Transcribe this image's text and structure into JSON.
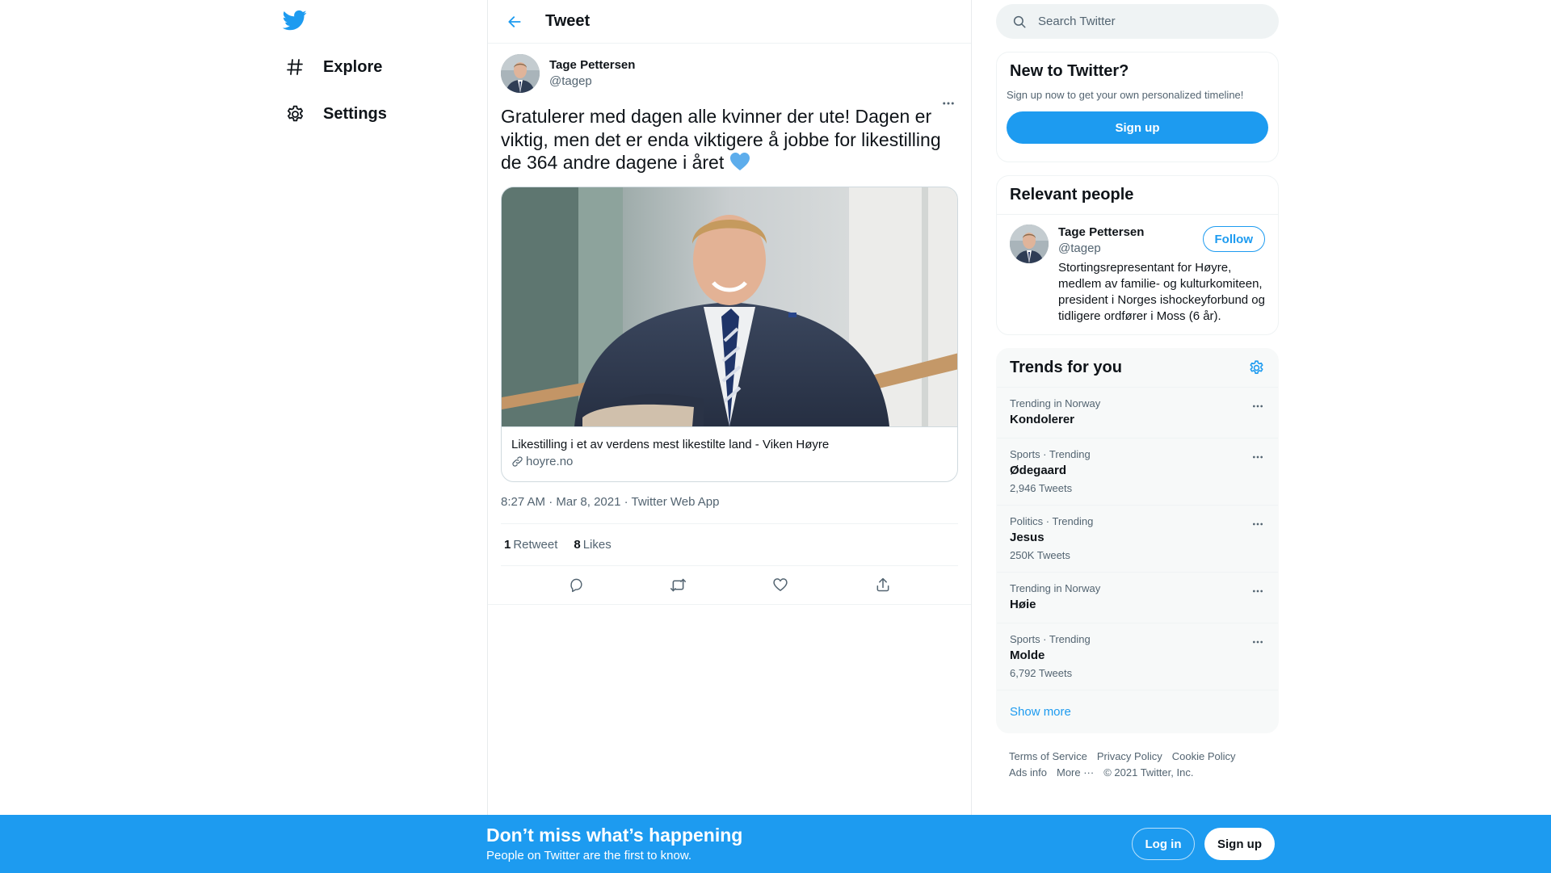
{
  "nav": {
    "items": [
      {
        "label": "Explore",
        "icon": "hashtag-icon"
      },
      {
        "label": "Settings",
        "icon": "gear-icon"
      }
    ]
  },
  "header": {
    "title": "Tweet"
  },
  "tweet": {
    "author_name": "Tage Pettersen",
    "author_handle": "@tagep",
    "text": "Gratulerer med dagen alle kvinner der ute! Dagen er viktig, men det er enda viktigere å jobbe for likestilling de 364 andre dagene i året",
    "emoji": "blue-heart",
    "card": {
      "title": "Likestilling i et av verdens mest likestilte land - Viken Høyre",
      "domain": "hoyre.no"
    },
    "time": "8:27 AM",
    "date": "Mar 8, 2021",
    "source": "Twitter Web App",
    "retweets": "1",
    "retweets_label": "Retweet",
    "likes": "8",
    "likes_label": "Likes"
  },
  "search": {
    "placeholder": "Search Twitter"
  },
  "new_to_twitter": {
    "title": "New to Twitter?",
    "subtitle": "Sign up now to get your own personalized timeline!",
    "button": "Sign up"
  },
  "relevant": {
    "title": "Relevant people",
    "name": "Tage Pettersen",
    "handle": "@tagep",
    "bio": "Stortingsrepresentant for Høyre, medlem av familie- og kulturkomiteen, president i Norges ishockeyforbund og tidligere ordfører i Moss (6 år).",
    "follow": "Follow"
  },
  "trends": {
    "title": "Trends for you",
    "items": [
      {
        "context": "Trending in Norway",
        "name": "Kondolerer",
        "count": ""
      },
      {
        "context": "Sports · Trending",
        "name": "Ødegaard",
        "count": "2,946 Tweets"
      },
      {
        "context": "Politics · Trending",
        "name": "Jesus",
        "count": "250K Tweets"
      },
      {
        "context": "Trending in Norway",
        "name": "Høie",
        "count": ""
      },
      {
        "context": "Sports · Trending",
        "name": "Molde",
        "count": "6,792 Tweets"
      }
    ],
    "show_more": "Show more"
  },
  "footer": {
    "terms": "Terms of Service",
    "privacy": "Privacy Policy",
    "cookie": "Cookie Policy",
    "ads": "Ads info",
    "more": "More ···",
    "copyright": "© 2021 Twitter, Inc."
  },
  "bottom": {
    "title": "Don’t miss what’s happening",
    "subtitle": "People on Twitter are the first to know.",
    "login": "Log in",
    "signup": "Sign up"
  },
  "colors": {
    "accent": "#1d9bf0",
    "text": "#0f1419",
    "secondary": "#536471"
  }
}
